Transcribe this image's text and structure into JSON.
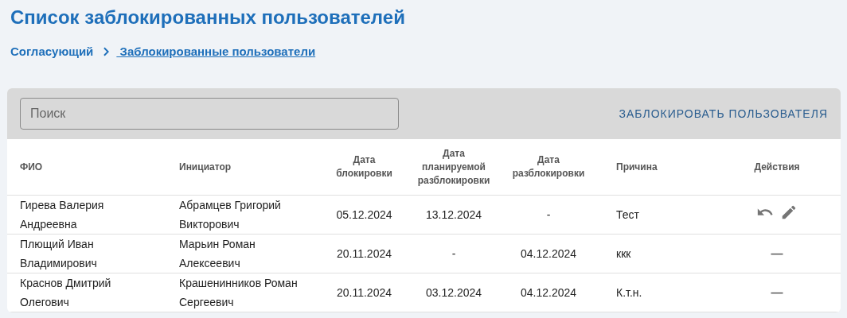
{
  "title": "Список заблокированных пользователей",
  "breadcrumbs": [
    {
      "label": "Согласующий",
      "current": false
    },
    {
      "label": " Заблокированные пользователи",
      "current": true
    }
  ],
  "search": {
    "placeholder": "Поиск"
  },
  "block_button": "ЗАБЛОКИРОВАТЬ ПОЛЬЗОВАТЕЛЯ",
  "table": {
    "columns": [
      "ФИО",
      "Инициатор",
      "Дата блокировки",
      "Дата планируемой разблокировки",
      "Дата разблокировки",
      "Причина",
      "Действия"
    ],
    "rows": [
      {
        "cells": [
          "Гирева Валерия Андреевна",
          "Абрамцев Григорий Викторович",
          "05.12.2024",
          "13.12.2024",
          "-",
          "Тест"
        ],
        "actions": {
          "kind": "icons"
        }
      },
      {
        "cells": [
          "Плющий Иван Владимирович",
          "Марьин Роман Алексеевич",
          "20.11.2024",
          "-",
          "04.12.2024",
          "ккк"
        ],
        "actions": {
          "kind": "text",
          "text": "—"
        }
      },
      {
        "cells": [
          "Краснов Дмитрий Олегович",
          "Крашенинников Роман Сергеевич",
          "20.11.2024",
          "03.12.2024",
          "04.12.2024",
          "К.т.н."
        ],
        "actions": {
          "kind": "text",
          "text": "—"
        }
      }
    ]
  }
}
